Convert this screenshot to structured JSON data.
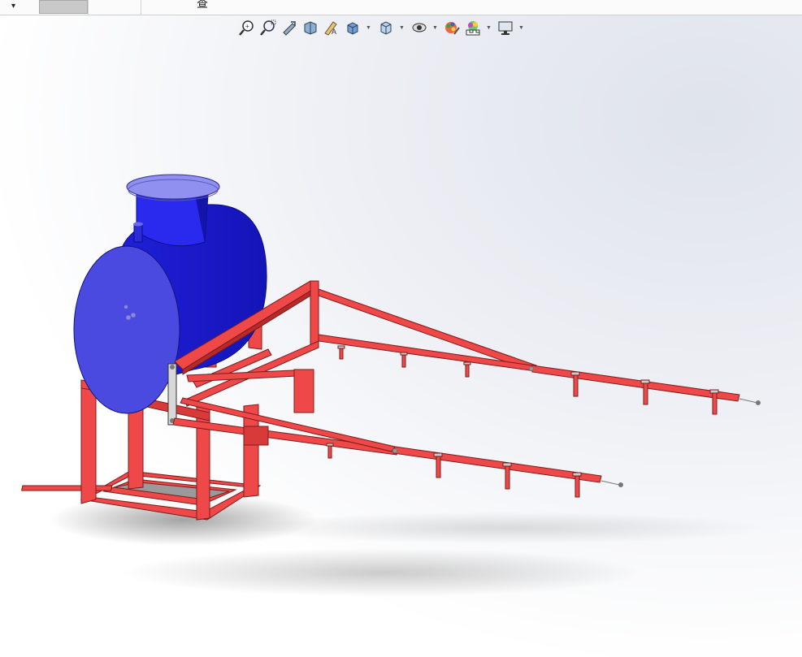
{
  "top_strip": {
    "dropdown_icon": "chevron-down-icon",
    "tab_glyph": "查"
  },
  "heads_up_toolbar": [
    {
      "name": "zoom-to-fit-icon"
    },
    {
      "name": "zoom-to-area-icon"
    },
    {
      "name": "previous-view-icon"
    },
    {
      "name": "section-view-icon"
    },
    {
      "name": "dynamic-annotation-views-icon"
    },
    {
      "name": "view-orientation-icon",
      "dropdown": true
    },
    {
      "name": "display-style-icon",
      "dropdown": true
    },
    {
      "name": "hide-show-items-icon",
      "dropdown": true
    },
    {
      "name": "edit-appearance-icon"
    },
    {
      "name": "apply-scene-icon",
      "dropdown": true
    },
    {
      "name": "view-settings-icon",
      "dropdown": true
    }
  ],
  "colors": {
    "tank": "#2a2ae6",
    "tank_face": "#4a4ae0",
    "lid": "#8f90f0",
    "frame": "#ee4848",
    "frame_dark": "#b82a2a"
  }
}
